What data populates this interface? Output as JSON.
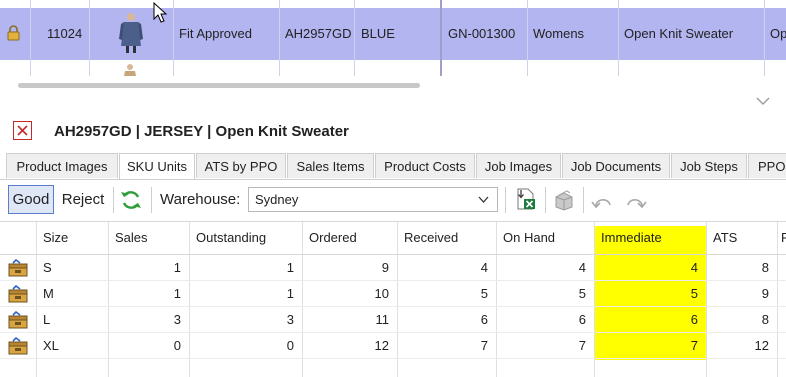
{
  "top_grid": {
    "row": {
      "id": "11024",
      "status": "Fit Approved",
      "style": "AH2957GD",
      "colour": "BLUE",
      "job": "GN-001300",
      "department": "Womens",
      "description": "Open Knit Sweater",
      "next_partial": "Op"
    },
    "highlight_color": "#b3b5f0"
  },
  "detail": {
    "title": "AH2957GD | JERSEY | Open Knit Sweater"
  },
  "tabs": [
    {
      "label": "Product Images",
      "active": false
    },
    {
      "label": "SKU Units",
      "active": true
    },
    {
      "label": "ATS by PPO",
      "active": false
    },
    {
      "label": "Sales Items",
      "active": false
    },
    {
      "label": "Product Costs",
      "active": false
    },
    {
      "label": "Job Images",
      "active": false
    },
    {
      "label": "Job Documents",
      "active": false
    },
    {
      "label": "Job Steps",
      "active": false
    },
    {
      "label": "PPO I",
      "active": false
    }
  ],
  "toolbar": {
    "good_label": "Good",
    "reject_label": "Reject",
    "warehouse_label": "Warehouse:",
    "warehouse_value": "Sydney",
    "icons": [
      "refresh-icon",
      "excel-export-icon",
      "box-icon",
      "undo-icon",
      "redo-icon"
    ]
  },
  "sku_table": {
    "columns": [
      "Size",
      "Sales",
      "Outstanding",
      "Ordered",
      "Received",
      "On Hand",
      "Immediate",
      "ATS",
      "F"
    ],
    "rows": [
      {
        "size": "S",
        "sales": "1",
        "outstanding": "1",
        "ordered": "9",
        "received": "4",
        "on_hand": "4",
        "immediate": "4",
        "ats": "8"
      },
      {
        "size": "M",
        "sales": "1",
        "outstanding": "1",
        "ordered": "10",
        "received": "5",
        "on_hand": "5",
        "immediate": "5",
        "ats": "9"
      },
      {
        "size": "L",
        "sales": "3",
        "outstanding": "3",
        "ordered": "11",
        "received": "6",
        "on_hand": "6",
        "immediate": "6",
        "ats": "8"
      },
      {
        "size": "XL",
        "sales": "0",
        "outstanding": "0",
        "ordered": "12",
        "received": "7",
        "on_hand": "7",
        "immediate": "7",
        "ats": "12"
      }
    ],
    "highlight_column": "Immediate",
    "highlight_color": "#ffff00"
  }
}
